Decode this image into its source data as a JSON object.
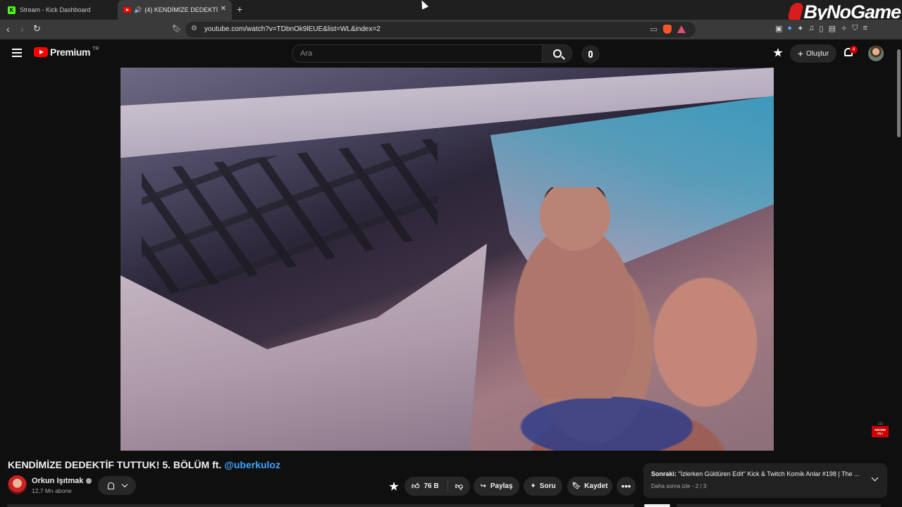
{
  "browser": {
    "tabs": [
      {
        "title": "Stream - Kick Dashboard",
        "icon": "kick-icon"
      },
      {
        "title": "(4) KENDİMİZE DEDEKTİF TUTTUK! 5. BÖLÜM ft. @uberkuloz",
        "icon": "youtube-icon",
        "audio": true
      }
    ],
    "url": "youtube.com/watch?v=TDbnOk9lEUE&list=WL&index=2",
    "watermark": "ByNoGame"
  },
  "youtube": {
    "logo_text": "Premium",
    "logo_region": "TR",
    "search_placeholder": "Ara",
    "create_label": "Oluştur",
    "notification_count": "4"
  },
  "video": {
    "title_main": "KENDİMİZE DEDEKTİF TUTTUK! 5. BÖLÜM ft. ",
    "title_link": "@uberkuloz",
    "overlay_subscribe": "ABONE OL!",
    "channel": {
      "name": "Orkun Işıtmak",
      "subscribers": "12,7 Mn abone"
    },
    "actions": {
      "likes": "76 B",
      "share": "Paylaş",
      "ask": "Soru",
      "save": "Kaydet"
    }
  },
  "playlist_next": {
    "label": "Sonraki:",
    "title": "\"İzlerken Güldüren Edit\" Kick & Twitch Komik Anlar #198 | The ...",
    "subtitle": "Daha sonra izle - 2 / 3"
  },
  "colors": {
    "youtube_red": "#ff0000",
    "link_blue": "#3ea6ff",
    "kick_green": "#53fc18"
  }
}
